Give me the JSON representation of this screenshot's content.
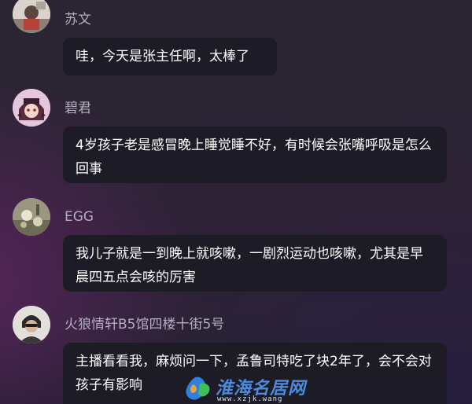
{
  "messages": [
    {
      "name": "苏文",
      "avatar": "avatar-photo",
      "text": "哇，今天是张主任啊，太棒了"
    },
    {
      "name": "碧君",
      "avatar": "avatar-anime",
      "text": "4岁孩子老是感冒晚上睡觉睡不好，有时候会张嘴呼吸是怎么回事"
    },
    {
      "name": "EGG",
      "avatar": "avatar-flower",
      "text": "我儿子就是一到晚上就咳嗽，一剧烈运动也咳嗽，尤其是早晨四五点会咳的厉害"
    },
    {
      "name": "火狼情轩B5馆四楼十街5号",
      "avatar": "avatar-person",
      "text": "主播看看我，麻烦问一下，孟鲁司特吃了块2年了，会不会对孩子有影响"
    }
  ],
  "watermark": {
    "text": "淮海名居网",
    "url": "www.xzjk.wang"
  }
}
